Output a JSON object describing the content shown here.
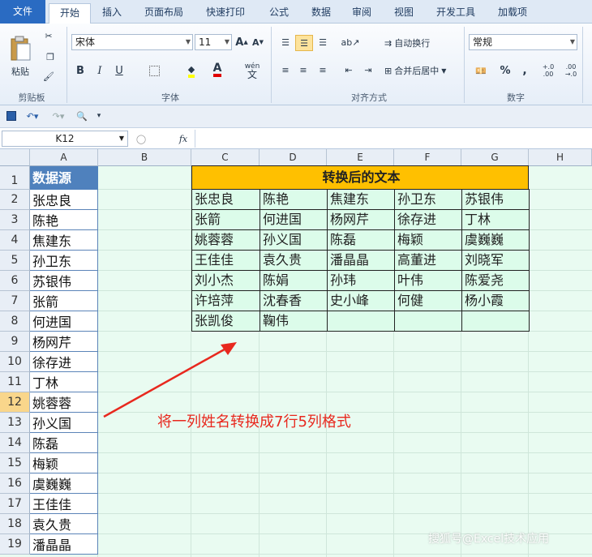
{
  "ribbon": {
    "tabs": [
      "文件",
      "开始",
      "插入",
      "页面布局",
      "快速打印",
      "公式",
      "数据",
      "审阅",
      "视图",
      "开发工具",
      "加载项"
    ],
    "clipboard": {
      "paste": "粘贴",
      "label": "剪贴板"
    },
    "font": {
      "name": "宋体",
      "size": "11",
      "label": "字体",
      "bold": "B",
      "italic": "I",
      "underline": "U",
      "wen": "wén"
    },
    "alignment": {
      "wrap": "自动换行",
      "merge": "合并后居中",
      "label": "对齐方式"
    },
    "number": {
      "format": "常规",
      "percent": "%",
      "comma": ",",
      "inc": "+.0 .00",
      "dec": ".00 →.0",
      "label": "数字"
    }
  },
  "formula_bar": {
    "name_box": "K12",
    "fx": "fx",
    "value": ""
  },
  "columns": [
    "A",
    "B",
    "C",
    "D",
    "E",
    "F",
    "G",
    "H"
  ],
  "rows": [
    "1",
    "2",
    "3",
    "4",
    "5",
    "6",
    "7",
    "8",
    "9",
    "10",
    "11",
    "12",
    "13",
    "14",
    "15",
    "16",
    "17",
    "18",
    "19"
  ],
  "selected_row": "12",
  "column_a": {
    "header": "数据源",
    "values": [
      "张忠良",
      "陈艳",
      "焦建东",
      "孙卫东",
      "苏银伟",
      "张箭",
      "何进国",
      "杨网芹",
      "徐存进",
      "丁林",
      "姚蓉蓉",
      "孙义国",
      "陈磊",
      "梅颖",
      "虞巍巍",
      "王佳佳",
      "袁久贵",
      "潘晶晶"
    ]
  },
  "result_table": {
    "title": "转换后的文本",
    "rows": [
      [
        "张忠良",
        "陈艳",
        "焦建东",
        "孙卫东",
        "苏银伟"
      ],
      [
        "张箭",
        "何进国",
        "杨网芹",
        "徐存进",
        "丁林"
      ],
      [
        "姚蓉蓉",
        "孙义国",
        "陈磊",
        "梅颖",
        "虞巍巍"
      ],
      [
        "王佳佳",
        "袁久贵",
        "潘晶晶",
        "高董进",
        "刘晓军"
      ],
      [
        "刘小杰",
        "陈娟",
        "孙玮",
        "叶伟",
        "陈爱尧"
      ],
      [
        "许培萍",
        "沈春香",
        "史小峰",
        "何健",
        "杨小霞"
      ],
      [
        "张凯俊",
        "鞠伟",
        "",
        "",
        ""
      ]
    ]
  },
  "annotation": {
    "text": "将一列姓名转换成7行5列格式",
    "color": "#e8281e"
  },
  "watermark": "搜狐号@Excel技术应用",
  "colors": {
    "accent": "#2a6bc2",
    "title_fill": "#ffc000",
    "header_fill": "#4f81bd",
    "sheet_bg": "#e9fbf1"
  }
}
